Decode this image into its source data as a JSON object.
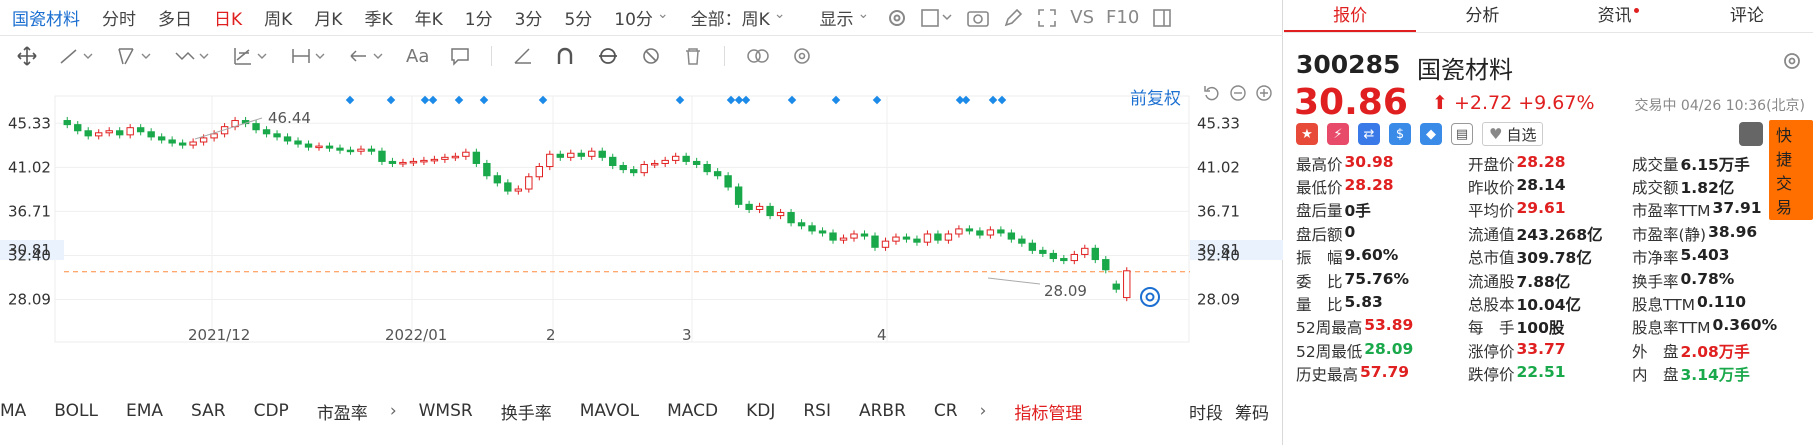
{
  "topbar": {
    "stock_name": "国瓷材料",
    "periods": [
      "分时",
      "多日",
      "日K",
      "周K",
      "月K",
      "季K",
      "年K",
      "1分",
      "3分",
      "5分",
      "10分"
    ],
    "active_period": "日K",
    "scope": "全部：周K",
    "display": "显示",
    "vs": "VS",
    "f10": "F10"
  },
  "chart": {
    "restore_label": "前复权",
    "price_label": "30.81",
    "high_label": "46.44",
    "low_label": "28.09",
    "y_ticks": [
      "45.33",
      "41.02",
      "36.71",
      "32.40",
      "28.09"
    ],
    "x_ticks": [
      "2021/12",
      "2022/01",
      "2",
      "3",
      "4"
    ]
  },
  "chart_data": {
    "type": "candlestick",
    "yticks": [
      45.33,
      41.02,
      36.71,
      32.4,
      28.09
    ],
    "ylim": [
      25.5,
      48
    ],
    "current_price": 30.81,
    "max_label": 46.44,
    "min_label": 28.09,
    "closes": [
      45.2,
      44.6,
      44.1,
      44.4,
      44.6,
      44.2,
      44.9,
      44.5,
      44.0,
      43.7,
      43.4,
      43.2,
      43.5,
      43.9,
      44.3,
      45.0,
      45.6,
      45.3,
      44.7,
      44.3,
      44.0,
      43.6,
      43.3,
      43.0,
      43.1,
      42.9,
      42.7,
      42.6,
      42.8,
      42.6,
      41.6,
      41.4,
      41.5,
      41.6,
      41.7,
      41.8,
      42.0,
      42.1,
      42.5,
      41.4,
      40.2,
      39.5,
      38.7,
      38.9,
      40.1,
      41.1,
      42.3,
      42.0,
      42.4,
      42.1,
      42.6,
      42.0,
      41.2,
      40.8,
      40.5,
      41.3,
      41.4,
      41.7,
      42.1,
      41.6,
      41.3,
      40.6,
      40.2,
      39.1,
      37.4,
      36.9,
      37.2,
      36.3,
      36.6,
      35.6,
      35.3,
      34.8,
      34.6,
      33.9,
      34.1,
      34.5,
      34.3,
      33.2,
      33.8,
      34.2,
      34.0,
      33.7,
      34.5,
      33.9,
      34.5,
      35.0,
      34.8,
      34.4,
      34.9,
      34.6,
      34.0,
      33.6,
      32.9,
      32.6,
      32.1,
      31.9,
      32.5,
      33.1,
      32.0,
      31.0,
      29.1,
      30.9
    ],
    "opens": [
      45.6,
      45.2,
      44.6,
      44.1,
      44.4,
      44.6,
      44.2,
      44.9,
      44.5,
      44.0,
      43.7,
      43.4,
      43.2,
      43.5,
      43.9,
      44.3,
      45.0,
      45.6,
      45.3,
      44.7,
      44.3,
      44.0,
      43.6,
      43.3,
      43.0,
      43.1,
      42.9,
      42.7,
      42.6,
      42.8,
      42.6,
      41.6,
      41.4,
      41.5,
      41.6,
      41.7,
      41.8,
      42.0,
      42.1,
      42.5,
      41.4,
      40.2,
      39.5,
      38.7,
      38.9,
      40.1,
      41.1,
      42.3,
      42.0,
      42.4,
      42.1,
      42.6,
      42.0,
      41.2,
      40.8,
      40.5,
      41.3,
      41.4,
      41.7,
      42.1,
      41.6,
      41.3,
      40.6,
      40.2,
      39.1,
      37.4,
      36.9,
      37.2,
      36.3,
      36.6,
      35.6,
      35.3,
      34.8,
      34.6,
      33.9,
      34.1,
      34.5,
      34.3,
      33.2,
      33.8,
      34.2,
      34.0,
      33.7,
      34.5,
      33.9,
      34.5,
      35.0,
      34.8,
      34.4,
      34.9,
      34.6,
      34.0,
      33.6,
      32.9,
      32.6,
      32.1,
      31.9,
      32.5,
      33.1,
      32.0,
      29.6,
      28.28
    ]
  },
  "indicators": [
    "MA",
    "BOLL",
    "EMA",
    "SAR",
    "CDP",
    "市盈率",
    "WMSR",
    "换手率",
    "MAVOL",
    "MACD",
    "KDJ",
    "RSI",
    "ARBR",
    "CR"
  ],
  "indicator_mgmt": "指标管理",
  "tail": [
    "时段",
    "筹码"
  ],
  "tabs": [
    {
      "label": "报价"
    },
    {
      "label": "分析"
    },
    {
      "label": "资讯"
    },
    {
      "label": "评论"
    }
  ],
  "stock": {
    "code": "300285",
    "name": "国瓷材料",
    "price": "30.86",
    "change": "+2.72",
    "pct": "+9.67%",
    "status": "交易中 04/26 10:36(北京)",
    "fav": "自选",
    "quick": "快捷交易"
  },
  "stats": [
    [
      {
        "k": "最高价",
        "v": "30.98",
        "c": "red"
      },
      {
        "k": "开盘价",
        "v": "28.28",
        "c": "red"
      },
      {
        "k": "成交量",
        "v": "6.15万手",
        "c": "blk"
      }
    ],
    [
      {
        "k": "最低价",
        "v": "28.28",
        "c": "red"
      },
      {
        "k": "昨收价",
        "v": "28.14",
        "c": "blk"
      },
      {
        "k": "成交额",
        "v": "1.82亿",
        "c": "blk"
      }
    ],
    [
      {
        "k": "盘后量",
        "v": "0手",
        "c": "blk"
      },
      {
        "k": "平均价",
        "v": "29.61",
        "c": "red"
      },
      {
        "k": "市盈率TTM",
        "v": "37.91",
        "c": "blk"
      }
    ],
    [
      {
        "k": "盘后额",
        "v": "0",
        "c": "blk"
      },
      {
        "k": "流通值",
        "v": "243.268亿",
        "c": "blk"
      },
      {
        "k": "市盈率(静)",
        "v": "38.96",
        "c": "blk"
      }
    ],
    [
      {
        "k": "振　幅",
        "v": "9.60%",
        "c": "blk"
      },
      {
        "k": "总市值",
        "v": "309.78亿",
        "c": "blk"
      },
      {
        "k": "市净率",
        "v": "5.403",
        "c": "blk"
      }
    ],
    [
      {
        "k": "委　比",
        "v": "75.76%",
        "c": "blk"
      },
      {
        "k": "流通股",
        "v": "7.88亿",
        "c": "blk"
      },
      {
        "k": "换手率",
        "v": "0.78%",
        "c": "blk"
      }
    ],
    [
      {
        "k": "量　比",
        "v": "5.83",
        "c": "blk"
      },
      {
        "k": "总股本",
        "v": "10.04亿",
        "c": "blk"
      },
      {
        "k": "股息TTM",
        "v": "0.110",
        "c": "blk"
      }
    ],
    [
      {
        "k": "52周最高",
        "v": "53.89",
        "c": "red"
      },
      {
        "k": "每　手",
        "v": "100股",
        "c": "blk"
      },
      {
        "k": "股息率TTM",
        "v": "0.360%",
        "c": "blk"
      }
    ],
    [
      {
        "k": "52周最低",
        "v": "28.09",
        "c": "green"
      },
      {
        "k": "涨停价",
        "v": "33.77",
        "c": "red"
      },
      {
        "k": "外　盘",
        "v": "2.08万手",
        "c": "red"
      }
    ],
    [
      {
        "k": "历史最高",
        "v": "57.79",
        "c": "red"
      },
      {
        "k": "跌停价",
        "v": "22.51",
        "c": "green"
      },
      {
        "k": "内　盘",
        "v": "3.14万手",
        "c": "green"
      }
    ]
  ]
}
